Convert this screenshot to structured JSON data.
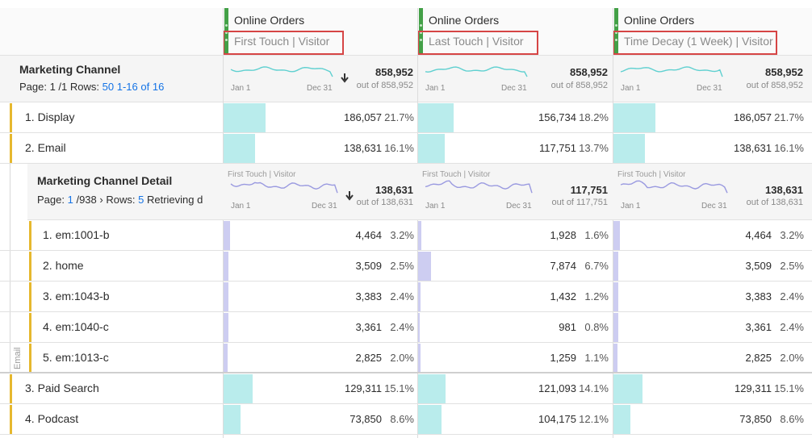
{
  "columns": [
    {
      "title": "Online Orders",
      "subtitle": "First Touch | Visitor",
      "total": "858,952",
      "out_of": "out of 858,952",
      "axis_start": "Jan 1",
      "axis_end": "Dec 31",
      "sorted": true,
      "detail": {
        "mini_title": "First Touch | Visitor",
        "total": "138,631",
        "out_of": "out of 138,631",
        "axis_start": "Jan 1",
        "axis_end": "Dec 31",
        "sorted": true
      }
    },
    {
      "title": "Online Orders",
      "subtitle": "Last Touch | Visitor",
      "total": "858,952",
      "out_of": "out of 858,952",
      "axis_start": "Jan 1",
      "axis_end": "Dec 31",
      "sorted": false,
      "detail": {
        "mini_title": "First Touch | Visitor",
        "total": "117,751",
        "out_of": "out of 117,751",
        "axis_start": "Jan 1",
        "axis_end": "Dec 31",
        "sorted": false
      }
    },
    {
      "title": "Online Orders",
      "subtitle": "Time Decay (1 Week) | Visitor",
      "total": "858,952",
      "out_of": "out of 858,952",
      "axis_start": "Jan 1",
      "axis_end": "Dec 31",
      "sorted": false,
      "detail": {
        "mini_title": "First Touch | Visitor",
        "total": "138,631",
        "out_of": "out of 138,631",
        "axis_start": "Jan 1",
        "axis_end": "Dec 31",
        "sorted": false
      }
    }
  ],
  "main_dim": {
    "title": "Marketing Channel",
    "page_label": "Page: 1 /1",
    "rows_label": "Rows:",
    "rows_value": "50",
    "range": "1-16 of 16"
  },
  "detail_dim": {
    "title": "Marketing Channel Detail",
    "page_label": "Page:",
    "page_current": "1",
    "page_total": "/938",
    "rows_label": "Rows:",
    "rows_value": "5",
    "status": "Retrieving d",
    "side_label": "Email"
  },
  "top_rows": [
    {
      "label": "1. Display",
      "cells": [
        {
          "v": "186,057",
          "p": "21.7%",
          "f": 0.217
        },
        {
          "v": "156,734",
          "p": "18.2%",
          "f": 0.182
        },
        {
          "v": "186,057",
          "p": "21.7%",
          "f": 0.217
        }
      ]
    },
    {
      "label": "2. Email",
      "cells": [
        {
          "v": "138,631",
          "p": "16.1%",
          "f": 0.161
        },
        {
          "v": "117,751",
          "p": "13.7%",
          "f": 0.137
        },
        {
          "v": "138,631",
          "p": "16.1%",
          "f": 0.161
        }
      ]
    }
  ],
  "detail_rows": [
    {
      "label": "1. em:1001-b",
      "cells": [
        {
          "v": "4,464",
          "p": "3.2%",
          "f": 0.032
        },
        {
          "v": "1,928",
          "p": "1.6%",
          "f": 0.016
        },
        {
          "v": "4,464",
          "p": "3.2%",
          "f": 0.032
        }
      ]
    },
    {
      "label": "2. home",
      "cells": [
        {
          "v": "3,509",
          "p": "2.5%",
          "f": 0.025
        },
        {
          "v": "7,874",
          "p": "6.7%",
          "f": 0.067
        },
        {
          "v": "3,509",
          "p": "2.5%",
          "f": 0.025
        }
      ]
    },
    {
      "label": "3. em:1043-b",
      "cells": [
        {
          "v": "3,383",
          "p": "2.4%",
          "f": 0.024
        },
        {
          "v": "1,432",
          "p": "1.2%",
          "f": 0.012
        },
        {
          "v": "3,383",
          "p": "2.4%",
          "f": 0.024
        }
      ]
    },
    {
      "label": "4. em:1040-c",
      "cells": [
        {
          "v": "3,361",
          "p": "2.4%",
          "f": 0.024
        },
        {
          "v": "981",
          "p": "0.8%",
          "f": 0.008
        },
        {
          "v": "3,361",
          "p": "2.4%",
          "f": 0.024
        }
      ]
    },
    {
      "label": "5. em:1013-c",
      "cells": [
        {
          "v": "2,825",
          "p": "2.0%",
          "f": 0.02
        },
        {
          "v": "1,259",
          "p": "1.1%",
          "f": 0.011
        },
        {
          "v": "2,825",
          "p": "2.0%",
          "f": 0.02
        }
      ]
    }
  ],
  "bottom_rows": [
    {
      "label": "3. Paid Search",
      "cells": [
        {
          "v": "129,311",
          "p": "15.1%",
          "f": 0.151
        },
        {
          "v": "121,093",
          "p": "14.1%",
          "f": 0.141
        },
        {
          "v": "129,311",
          "p": "15.1%",
          "f": 0.151
        }
      ]
    },
    {
      "label": "4. Podcast",
      "cells": [
        {
          "v": "73,850",
          "p": "8.6%",
          "f": 0.086
        },
        {
          "v": "104,175",
          "p": "12.1%",
          "f": 0.121
        },
        {
          "v": "73,850",
          "p": "8.6%",
          "f": 0.086
        }
      ]
    }
  ],
  "colors": {
    "accent_green": "#43a047",
    "highlight_red": "#d64545",
    "bar_top": "#b9ecec",
    "bar_detail": "#cdcdf1",
    "row_marker": "#e6b82e",
    "sparkline_top": "#5fd0d0",
    "sparkline_detail": "#9a9ae0"
  },
  "icons": {
    "sort": "sort-down-arrow-icon",
    "breadcrumb": "chevron-right-icon"
  }
}
